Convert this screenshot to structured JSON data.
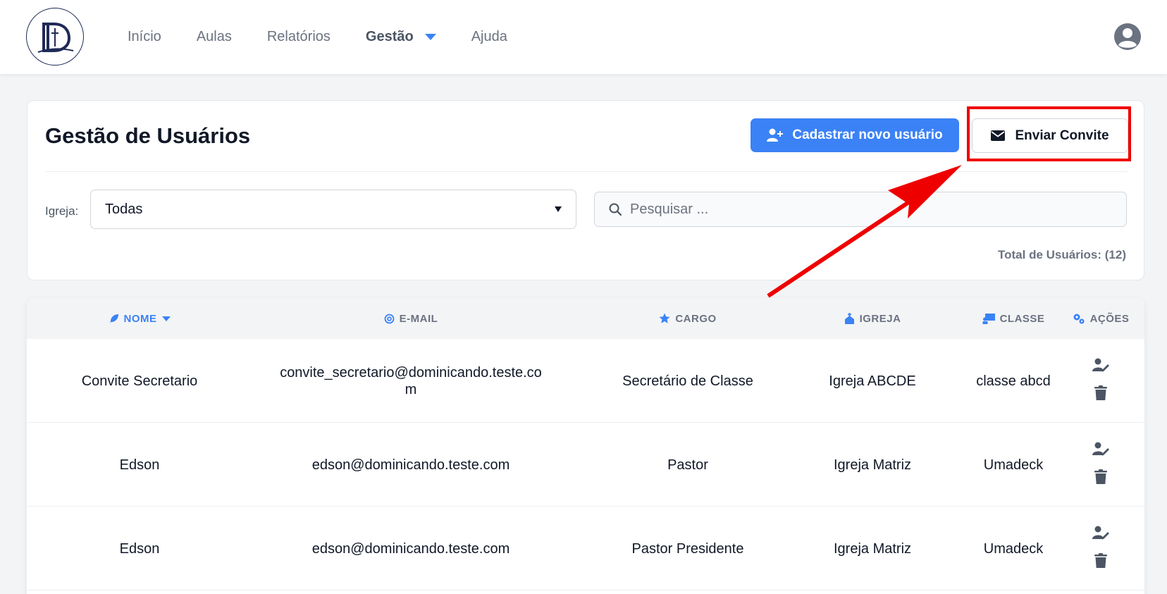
{
  "nav": {
    "items": [
      {
        "label": "Início"
      },
      {
        "label": "Aulas"
      },
      {
        "label": "Relatórios"
      },
      {
        "label": "Gestão"
      },
      {
        "label": "Ajuda"
      }
    ],
    "active": "Gestão"
  },
  "header": {
    "title": "Gestão de Usuários",
    "new_user_label": "Cadastrar novo usuário",
    "invite_label": "Enviar Convite"
  },
  "filters": {
    "church_label": "Igreja:",
    "church_value": "Todas",
    "search_placeholder": "Pesquisar ..."
  },
  "total_label": "Total de Usuários: (12)",
  "table": {
    "headers": [
      "NOME",
      "E-MAIL",
      "CARGO",
      "IGREJA",
      "CLASSE",
      "AÇÕES"
    ],
    "sorted_column": "NOME",
    "rows": [
      {
        "name": "Convite Secretario",
        "email": "convite_secretario@dominicando.teste.com",
        "role": "Secretário de Classe",
        "church": "Igreja ABCDE",
        "class": "classe abcd"
      },
      {
        "name": "Edson",
        "email": "edson@dominicando.teste.com",
        "role": "Pastor",
        "church": "Igreja Matriz",
        "class": "Umadeck"
      },
      {
        "name": "Edson",
        "email": "edson@dominicando.teste.com",
        "role": "Pastor Presidente",
        "church": "Igreja Matriz",
        "class": "Umadeck"
      }
    ]
  },
  "colors": {
    "accent": "#3b82f6",
    "annotation": "#ef0000"
  }
}
